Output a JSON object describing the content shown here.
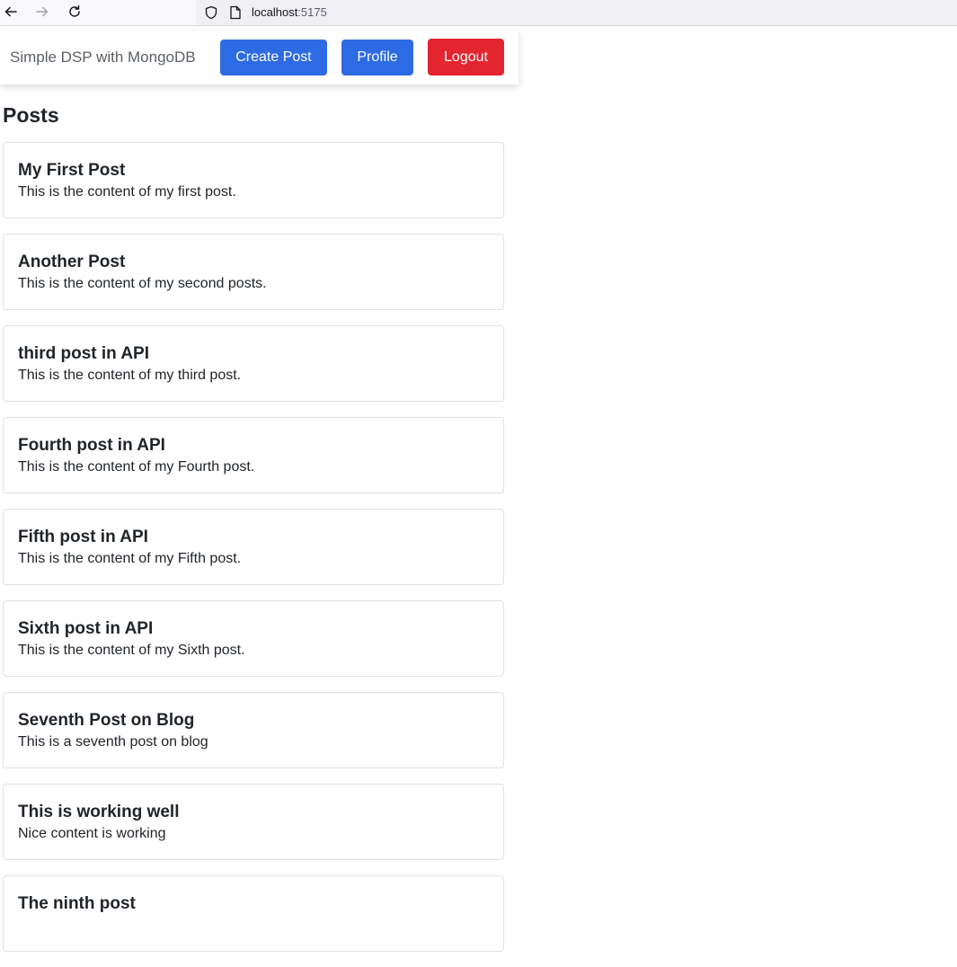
{
  "browser": {
    "url_host": "localhost",
    "url_port": ":5175"
  },
  "navbar": {
    "brand": "Simple DSP with MongoDB",
    "create_post_label": "Create Post",
    "profile_label": "Profile",
    "logout_label": "Logout"
  },
  "colors": {
    "primary": "#2d6be4",
    "danger": "#e3252f"
  },
  "main": {
    "heading": "Posts",
    "posts": [
      {
        "title": "My First Post",
        "content": "This is the content of my first post."
      },
      {
        "title": "Another Post",
        "content": "This is the content of my second posts."
      },
      {
        "title": "third post in API",
        "content": "This is the content of my third post."
      },
      {
        "title": "Fourth post in API",
        "content": "This is the content of my Fourth post."
      },
      {
        "title": "Fifth post in API",
        "content": "This is the content of my Fifth post."
      },
      {
        "title": "Sixth post in API",
        "content": "This is the content of my Sixth post."
      },
      {
        "title": "Seventh Post on Blog",
        "content": "This is a seventh post on blog"
      },
      {
        "title": "This is working well",
        "content": "Nice content is working"
      },
      {
        "title": "The ninth post",
        "content": ""
      }
    ]
  }
}
